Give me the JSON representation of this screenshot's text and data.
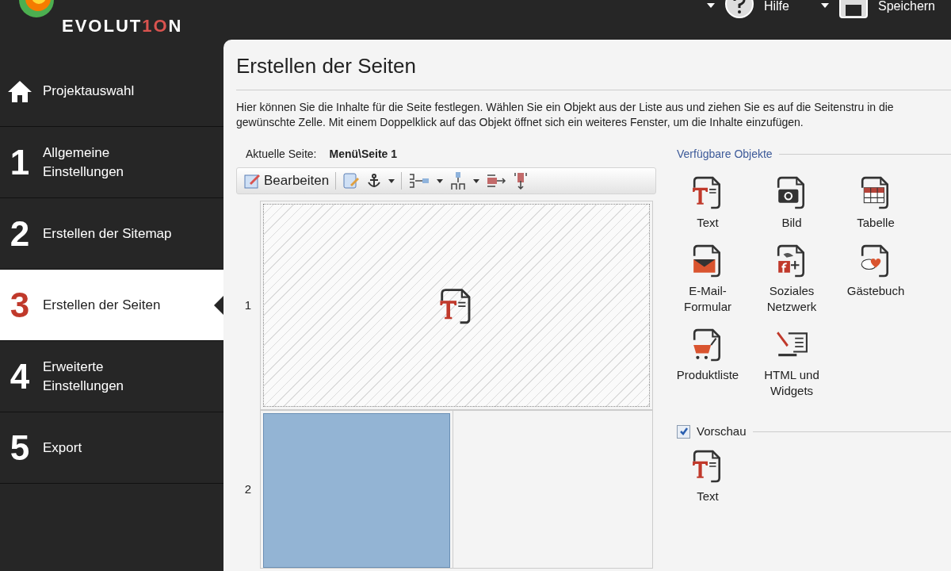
{
  "header": {
    "logo_parts": [
      {
        "text": "EVOLUT",
        "accent": false
      },
      {
        "text": "1O",
        "accent": true
      },
      {
        "text": "N",
        "accent": false
      }
    ],
    "actions": [
      {
        "label": "Hilfe",
        "kind": "help"
      },
      {
        "label": "Speichern",
        "kind": "save"
      }
    ]
  },
  "sidebar": {
    "items": [
      {
        "marker": "",
        "kind": "home",
        "label": "Projektauswahl",
        "selected": false
      },
      {
        "marker": "1",
        "kind": "step",
        "label": "Allgemeine Einstellungen",
        "selected": false
      },
      {
        "marker": "2",
        "kind": "step",
        "label": "Erstellen der Sitemap",
        "selected": false
      },
      {
        "marker": "3",
        "kind": "step",
        "label": "Erstellen der Seiten",
        "selected": true
      },
      {
        "marker": "4",
        "kind": "step",
        "label": "Erweiterte Einstellungen",
        "selected": false
      },
      {
        "marker": "5",
        "kind": "step",
        "label": "Export",
        "selected": false
      }
    ]
  },
  "main": {
    "title": "Erstellen der Seiten",
    "description": "Hier können Sie die Inhalte für die Seite festlegen. Wählen Sie ein Objekt aus der Liste aus und ziehen Sie es auf die Seitenstru in die gewünschte Zelle.  Mit einem Doppelklick auf das Objekt öffnet sich ein weiteres Fenster, um die Inhalte einzufügen.",
    "current_page_label": "Aktuelle Seite:",
    "current_page": "Menü\\Seite 1",
    "toolbar": {
      "edit_button": "Bearbeiten"
    },
    "grid": {
      "rows": [
        {
          "label": "1"
        },
        {
          "label": "2"
        }
      ]
    },
    "objects_heading": "Verfügbare Objekte",
    "objects": [
      {
        "kind": "text",
        "label": "Text"
      },
      {
        "kind": "image",
        "label": "Bild"
      },
      {
        "kind": "table",
        "label": "Tabelle"
      },
      {
        "kind": "email",
        "label": "E-Mail-\nFormular"
      },
      {
        "kind": "social",
        "label": "Soziales\nNetzwerk"
      },
      {
        "kind": "guestbook",
        "label": "Gästebuch"
      },
      {
        "kind": "cart",
        "label": "Produktliste"
      },
      {
        "kind": "html",
        "label": "HTML und\nWidgets"
      }
    ],
    "preview": {
      "label": "Vorschau",
      "checked": true,
      "object": {
        "kind": "text",
        "label": "Text"
      }
    }
  }
}
